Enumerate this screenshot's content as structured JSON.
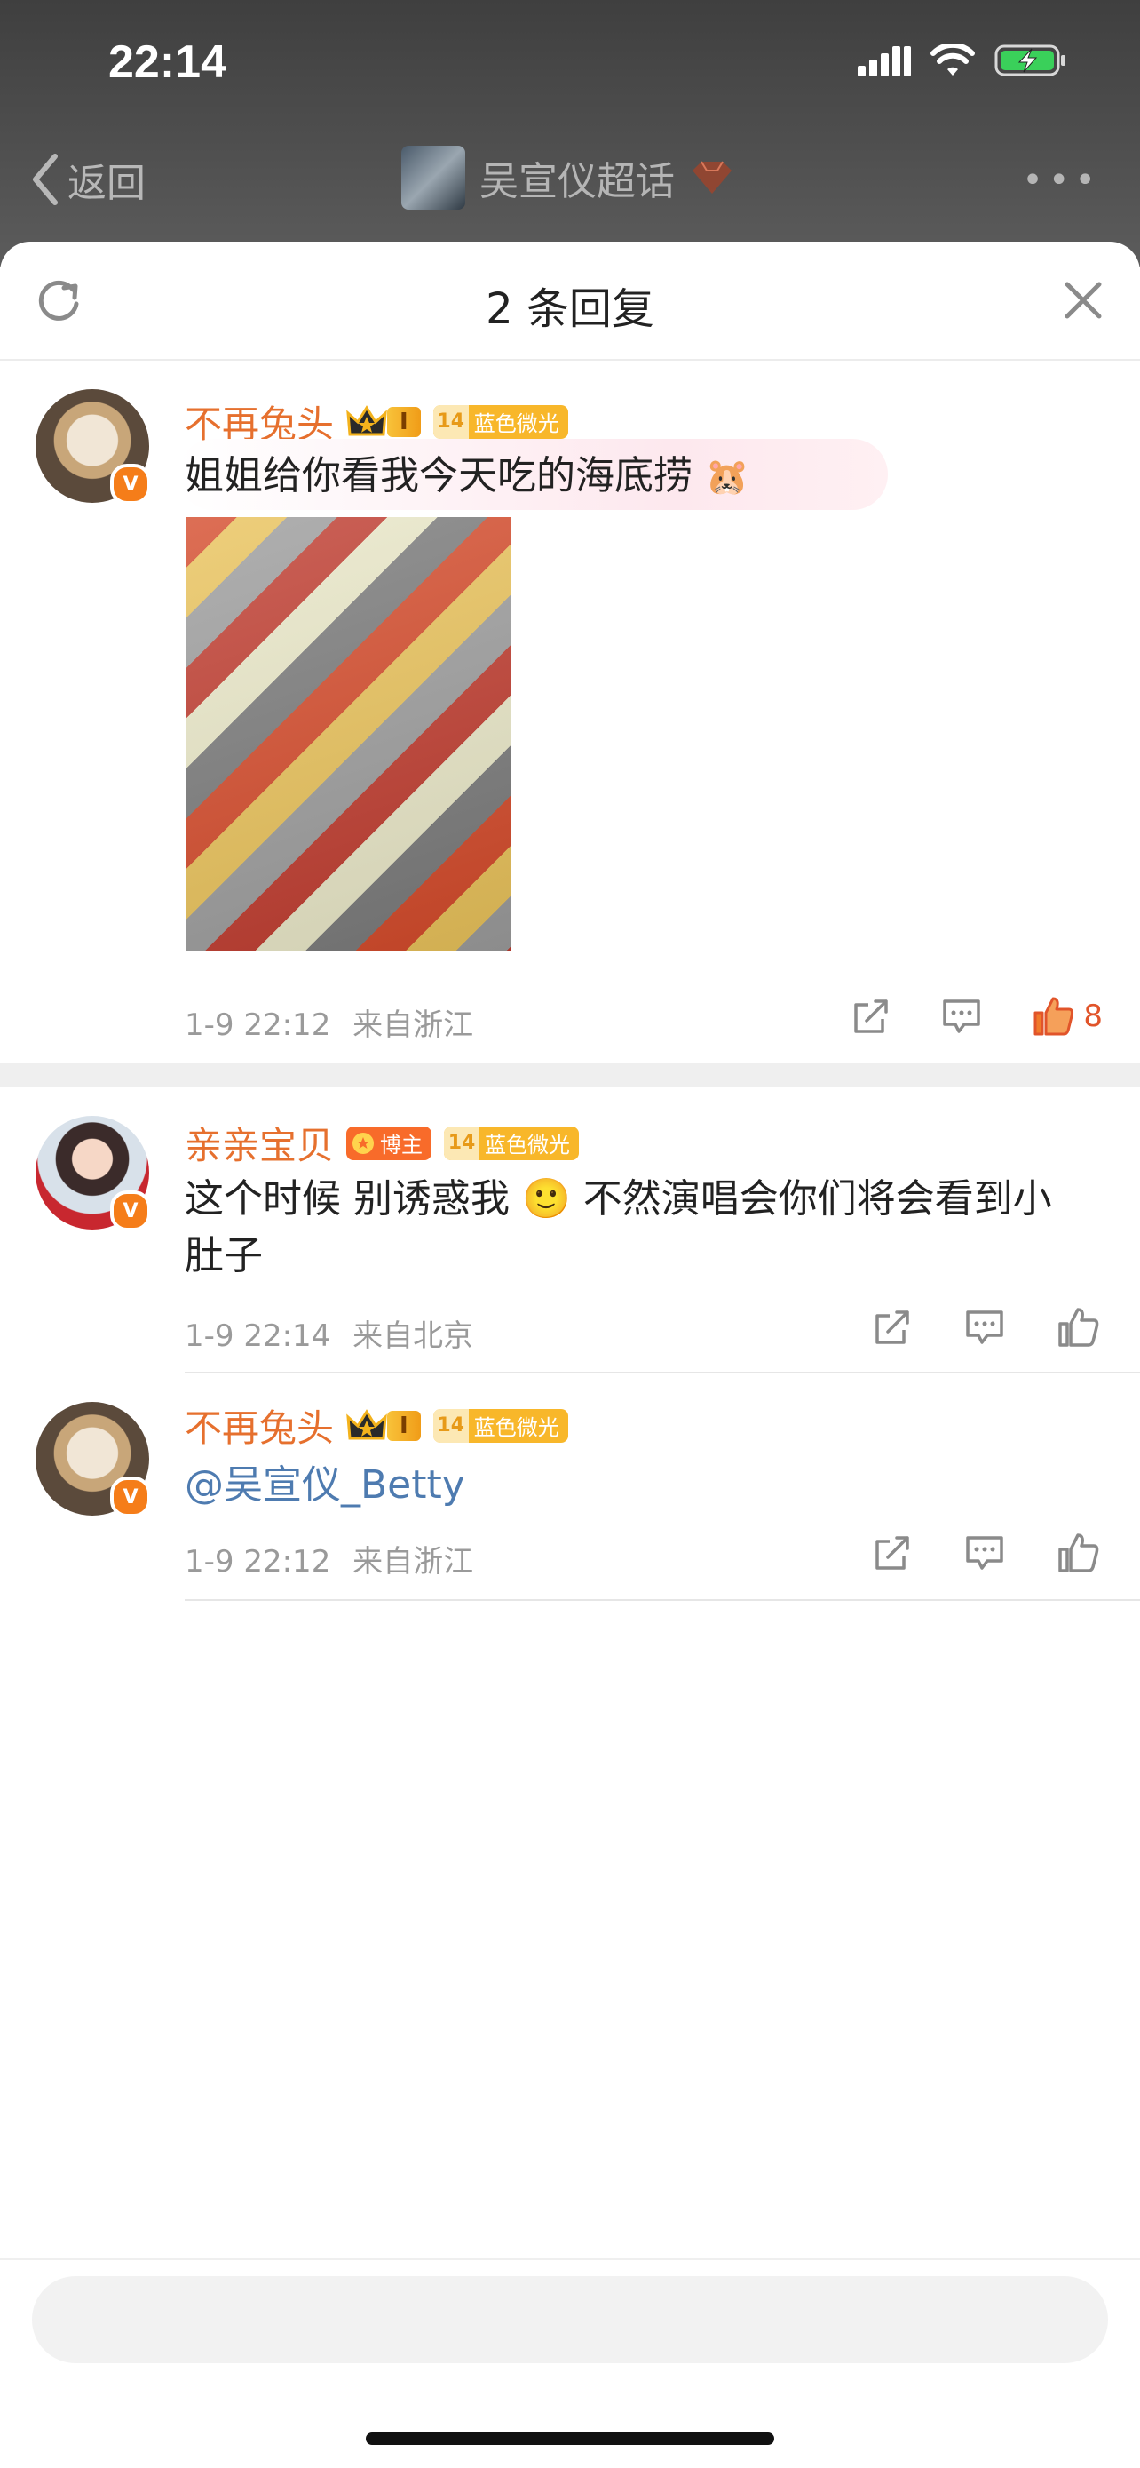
{
  "status_bar": {
    "time": "22:14"
  },
  "nav": {
    "back_label": "返回",
    "title": "吴宣仪超话"
  },
  "sheet": {
    "title": "2 条回复"
  },
  "comments": [
    {
      "author": "不再兔头",
      "level_badge": "I",
      "fan_level": "14",
      "fan_badge_text": "蓝色微光",
      "text": "姐姐给你看我今天吃的海底捞",
      "timestamp": "1-9 22:12",
      "location": "来自浙江",
      "like_count": "8"
    },
    {
      "author": "亲亲宝贝",
      "blogger_badge": "博主",
      "fan_level": "14",
      "fan_badge_text": "蓝色微光",
      "text_line1": "这个时候 别诱惑我 🙂 不然演唱会你们将会看到小",
      "text_line2": "肚子",
      "timestamp": "1-9 22:14",
      "location": "来自北京"
    },
    {
      "author": "不再兔头",
      "level_badge": "I",
      "fan_level": "14",
      "fan_badge_text": "蓝色微光",
      "mention": "@吴宣仪_Betty",
      "timestamp": "1-9 22:12",
      "location": "来自浙江"
    }
  ],
  "colors": {
    "name": "#e6702e",
    "like_active": "#e1542a",
    "mention": "#4e7bb0",
    "meta": "#9a9a9a"
  },
  "icons": [
    "signal-icon",
    "wifi-icon",
    "battery-icon",
    "back-chevron-icon",
    "more-icon",
    "refresh-icon",
    "close-icon",
    "share-icon",
    "comment-icon",
    "like-icon",
    "crown-icon"
  ]
}
